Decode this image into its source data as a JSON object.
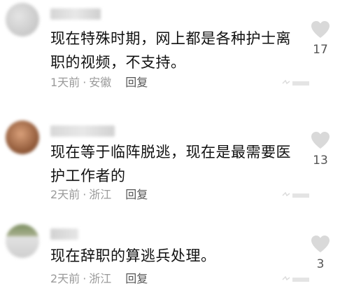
{
  "comments": [
    {
      "text": "现在特殊时期，网上都是各种护士离职的视频，不支持。",
      "time": "1天前",
      "location": "安徽",
      "reply_label": "回复",
      "likes": "17",
      "avatar_colors": [
        "#cfcfcf",
        "#e6e6e6"
      ]
    },
    {
      "text": "现在等于临阵脱逃，现在是最需要医护工作者的",
      "time": "2天前",
      "location": "浙江",
      "reply_label": "回复",
      "likes": "13",
      "avatar_colors": [
        "#c68a62",
        "#7a4a2e"
      ]
    },
    {
      "text": "现在辞职的算逃兵处理。",
      "time": "2天前",
      "location": "浙江",
      "reply_label": "回复",
      "likes": "3",
      "avatar_colors": [
        "#8a9a70",
        "#d8d8d8"
      ]
    }
  ],
  "icons": {
    "like": "heart-icon",
    "watermark": "app-logo"
  },
  "colors": {
    "like_icon": "#d9d9d9",
    "meta_text": "#9a9a9a",
    "reply_text": "#555555"
  }
}
